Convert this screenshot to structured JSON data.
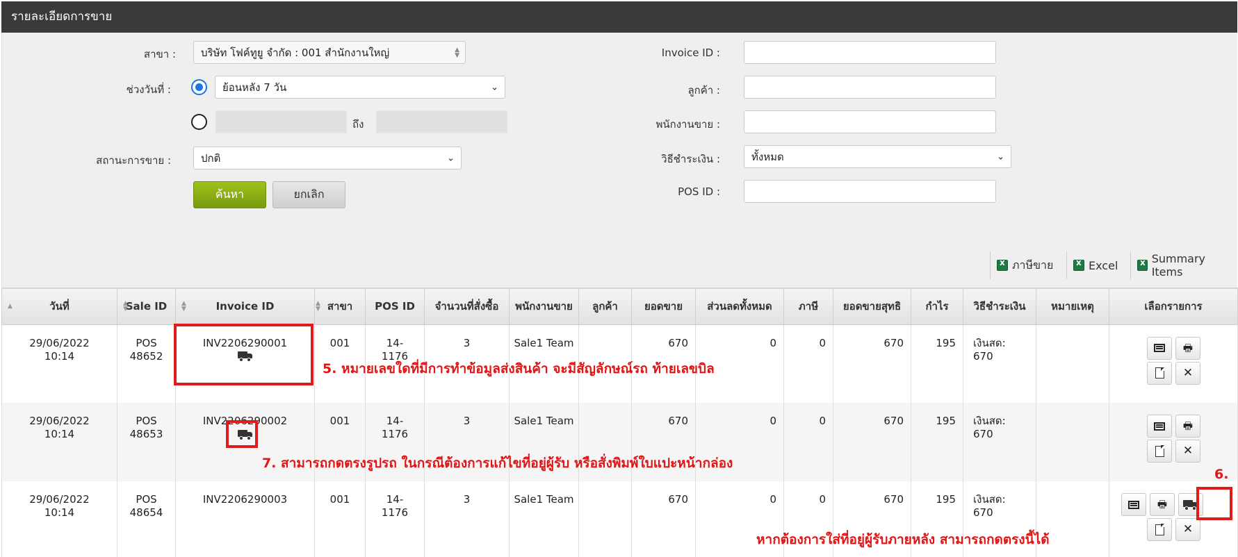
{
  "window": {
    "title": "รายละเอียดการขาย"
  },
  "filters": {
    "branch_label": "สาขา :",
    "branch_value": "บริษัท โฟค์ทูยู จำกัด : 001 สำนักงานใหญ่",
    "date_range_label": "ช่วงวันที่ :",
    "date_preset_value": "ย้อนหลัง 7 วัน",
    "date_to_label": "ถึง",
    "sale_status_label": "สถานะการขาย :",
    "sale_status_value": "ปกติ",
    "invoice_label": "Invoice ID :",
    "invoice_value": "",
    "customer_label": "ลูกค้า :",
    "customer_value": "",
    "salesperson_label": "พนักงานขาย :",
    "salesperson_value": "",
    "payment_label": "วิธีชำระเงิน :",
    "payment_value": "ทั้งหมด",
    "pos_label": "POS ID :",
    "pos_value": "",
    "search_button": "ค้นหา",
    "cancel_button": "ยกเลิก"
  },
  "export": {
    "tax_sale": "ภาษีขาย",
    "excel": "Excel",
    "summary_items": "Summary Items"
  },
  "table": {
    "headers": [
      "วันที่",
      "Sale ID",
      "Invoice ID",
      "สาขา",
      "POS ID",
      "จำนวนที่สั่งซื้อ",
      "พนักงานขาย",
      "ลูกค้า",
      "ยอดขาย",
      "ส่วนลดทั้งหมด",
      "ภาษี",
      "ยอดขายสุทธิ",
      "กำไร",
      "วิธีชำระเงิน",
      "หมายเหตุ",
      "เลือกรายการ"
    ],
    "rows": [
      {
        "date": "29/06/2022",
        "time": "10:14",
        "sale_a": "POS",
        "sale_b": "48652",
        "invoice": "INV2206290001",
        "branch": "001",
        "pos_a": "14-",
        "pos_b": "1176",
        "qty": "3",
        "staff": "Sale1 Team",
        "customer": "",
        "sales": "670",
        "discount": "0",
        "tax": "0",
        "net": "670",
        "profit": "195",
        "pay_a": "เงินสด:",
        "pay_b": "670",
        "note": ""
      },
      {
        "date": "29/06/2022",
        "time": "10:14",
        "sale_a": "POS",
        "sale_b": "48653",
        "invoice": "INV2206290002",
        "branch": "001",
        "pos_a": "14-",
        "pos_b": "1176",
        "qty": "3",
        "staff": "Sale1 Team",
        "customer": "",
        "sales": "670",
        "discount": "0",
        "tax": "0",
        "net": "670",
        "profit": "195",
        "pay_a": "เงินสด:",
        "pay_b": "670",
        "note": ""
      },
      {
        "date": "29/06/2022",
        "time": "10:14",
        "sale_a": "POS",
        "sale_b": "48654",
        "invoice": "INV2206290003",
        "branch": "001",
        "pos_a": "14-",
        "pos_b": "1176",
        "qty": "3",
        "staff": "Sale1 Team",
        "customer": "",
        "sales": "670",
        "discount": "0",
        "tax": "0",
        "net": "670",
        "profit": "195",
        "pay_a": "เงินสด:",
        "pay_b": "670",
        "note": ""
      }
    ]
  },
  "annotations": {
    "note5": "5. หมายเลขใดที่มีการทำข้อมูลส่งสินค้า จะมีสัญลักษณ์รถ ท้ายเลขบิล",
    "note7": "7. สามารถกดตรงรูปรถ ในกรณีต้องการแก้ไขที่อยู่ผู้รับ หรือสั่งพิมพ์ใบแปะหน้ากล่อง",
    "note6_num": "6.",
    "note6": "หากต้องการใส่ที่อยู่ผู้รับภายหลัง สามารถกดตรงนี้ได้"
  },
  "colors": {
    "title_bg": "#3a3a3a",
    "search_btn": "#8fb214",
    "annotation_red": "#e01515",
    "radio_blue": "#1a73e8"
  },
  "icons": [
    "truck-icon",
    "list-icon",
    "print-icon",
    "document-icon",
    "close-icon",
    "excel-icon",
    "chevron-down-icon",
    "sort-icon"
  ]
}
